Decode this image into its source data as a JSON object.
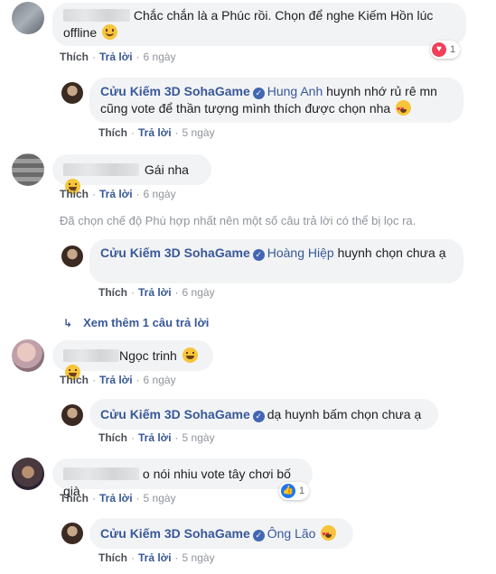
{
  "colors": {
    "link": "#385898",
    "bubble": "#f2f3f5",
    "meta": "#90949c"
  },
  "actions": {
    "like": "Thích",
    "reply": "Trả lời"
  },
  "page_name": "Cửu Kiếm 3D SohaGame",
  "comments": [
    {
      "text": "Chắc chắn là a Phúc rồi. Chọn để nghe Kiếm Hồn lúc offline",
      "emoji": "smile",
      "time": "6 ngày",
      "reactions": {
        "type": "love",
        "count": "1"
      }
    },
    {
      "tag": "Hung Anh",
      "text": "huynh nhớ rủ rê mn cũng vote để thần tượng mình thích được chọn nha",
      "emoji": "hearteyes",
      "time": "5 ngày"
    },
    {
      "text": "Gái nha",
      "emoji": "grin",
      "time": "6 ngày"
    },
    {
      "tag": "Hoàng Hiệp",
      "text": "huynh chọn chưa ạ",
      "time": "6 ngày"
    },
    {
      "text": "Ngọc trinh",
      "emoji": "grin",
      "time": "6 ngày"
    },
    {
      "tag": "dạ huynh bấm chọn chưa ạ",
      "time": "5 ngày"
    },
    {
      "text": "o nói nhiu vote tây chơi bố già",
      "time": "5 ngày",
      "reactions": {
        "type": "like",
        "count": "1"
      }
    },
    {
      "tag": "Ông Lão",
      "emoji": "hearteyes",
      "time": "5 ngày"
    }
  ],
  "filter_notice": "Đã chọn chế độ Phù hợp nhất nên một số câu trả lời có thể bị lọc ra.",
  "more_replies": "Xem thêm 1 câu trả lời"
}
